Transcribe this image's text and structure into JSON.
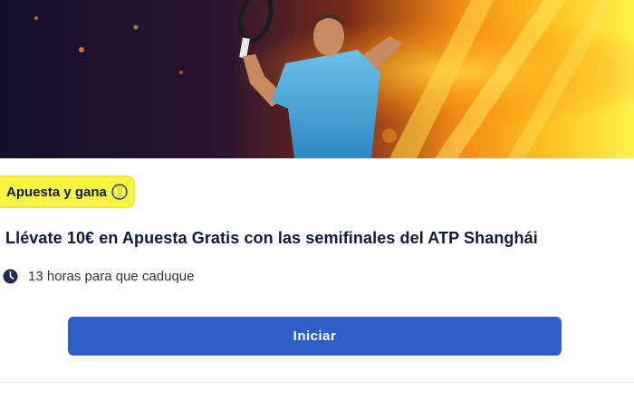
{
  "promo": {
    "badge_label": "Apuesta y gana",
    "title": "Llévate 10€ en Apuesta Gratis con las semifinales del ATP Shanghái",
    "expiry_text": "13 horas para que caduque",
    "cta_label": "Iniciar"
  },
  "icons": {
    "badge": "tennis-ball-icon",
    "expiry": "clock-icon"
  },
  "colors": {
    "badge_bg": "#f8f544",
    "cta_bg": "#2f5fc6",
    "title": "#0e1a3c"
  }
}
